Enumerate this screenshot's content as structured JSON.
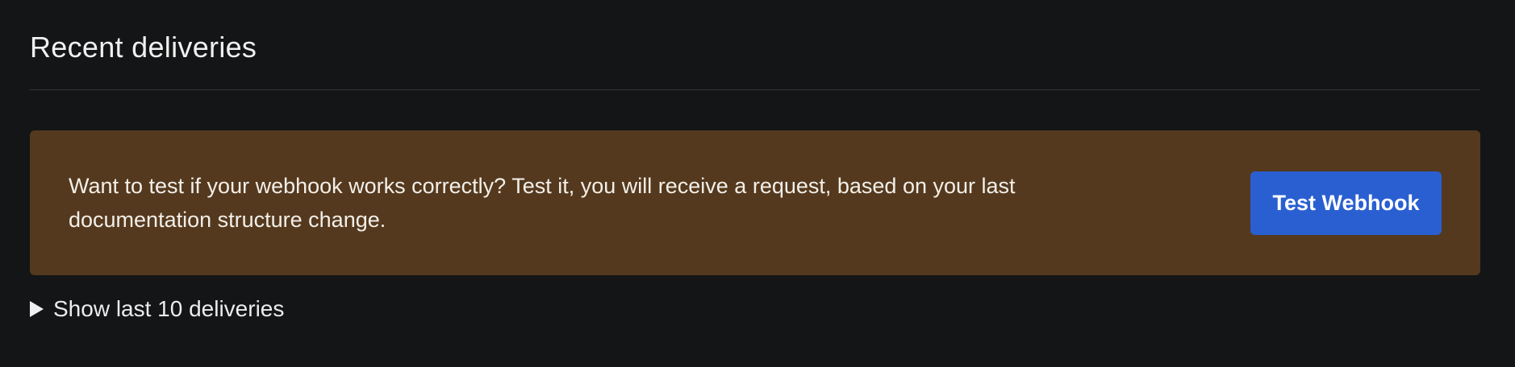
{
  "section": {
    "title": "Recent deliveries"
  },
  "notice": {
    "text": "Want to test if your webhook works correctly? Test it, you will receive a request, based on your last documentation structure change.",
    "button_label": "Test Webhook",
    "background_color": "#54391e",
    "button_color": "#2a5fd1"
  },
  "deliveries_toggle": {
    "label": "Show last 10 deliveries",
    "icon": "triangle-right-icon"
  }
}
